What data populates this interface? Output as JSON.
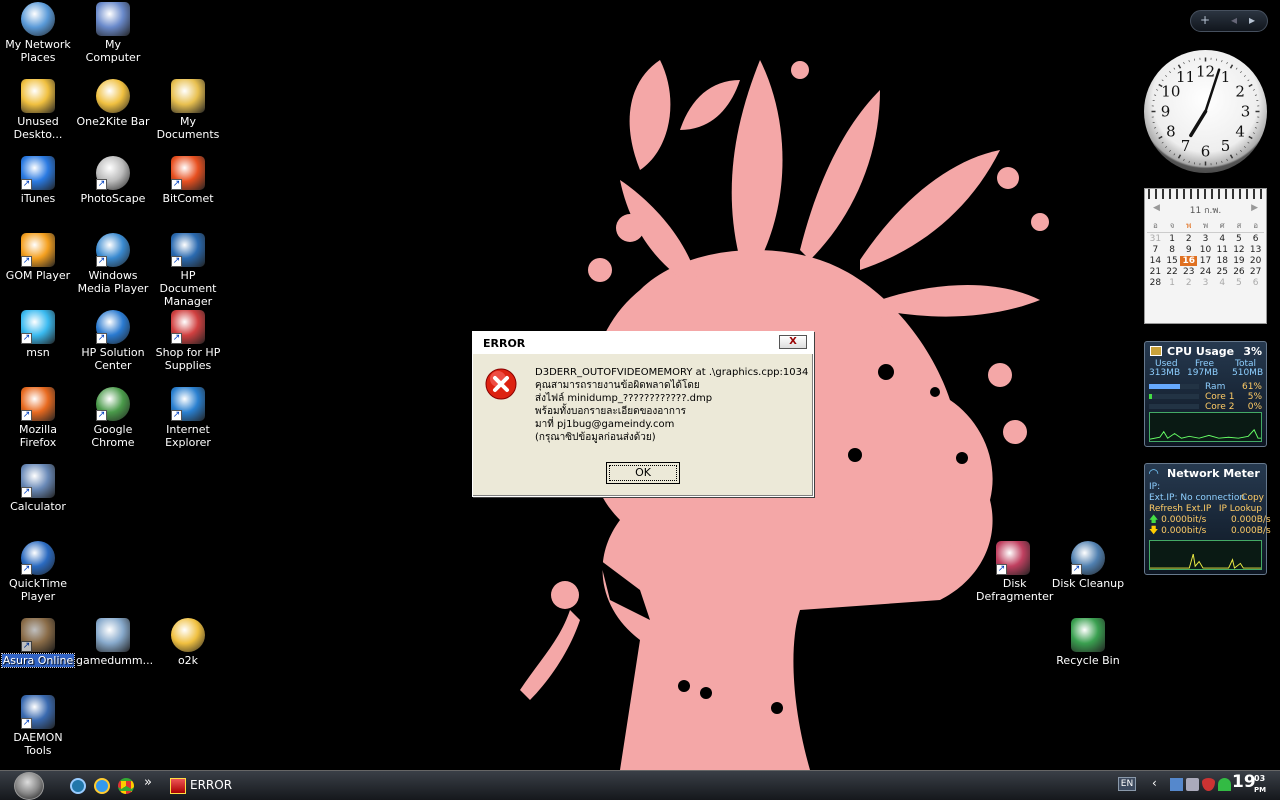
{
  "desktop": {
    "icons": [
      {
        "label": "My Network Places",
        "name": "my-network-places-icon",
        "sel": false
      },
      {
        "label": "My Computer",
        "name": "my-computer-icon",
        "sel": false
      },
      {
        "label": "Unused Deskto...",
        "name": "unused-desktop-folder-icon",
        "sel": false
      },
      {
        "label": "One2Kite Bar",
        "name": "one2kite-bar-folder-icon",
        "sel": false
      },
      {
        "label": "My Documents",
        "name": "my-documents-icon",
        "sel": false
      },
      {
        "label": "iTunes",
        "name": "itunes-icon",
        "sel": false
      },
      {
        "label": "PhotoScape",
        "name": "photoscape-icon",
        "sel": false
      },
      {
        "label": "BitComet",
        "name": "bitcomet-icon",
        "sel": false
      },
      {
        "label": "GOM Player",
        "name": "gom-player-icon",
        "sel": false
      },
      {
        "label": "Windows Media Player",
        "name": "windows-media-player-icon",
        "sel": false
      },
      {
        "label": "HP Document Manager",
        "name": "hp-document-manager-icon",
        "sel": false
      },
      {
        "label": "msn",
        "name": "msn-icon",
        "sel": false
      },
      {
        "label": "HP Solution Center",
        "name": "hp-solution-center-icon",
        "sel": false
      },
      {
        "label": "Shop for HP Supplies",
        "name": "shop-hp-supplies-icon",
        "sel": false
      },
      {
        "label": "Mozilla Firefox",
        "name": "mozilla-firefox-icon",
        "sel": false
      },
      {
        "label": "Google Chrome",
        "name": "google-chrome-icon",
        "sel": false
      },
      {
        "label": "Internet Explorer",
        "name": "internet-explorer-icon",
        "sel": false
      },
      {
        "label": "Calculator",
        "name": "calculator-icon",
        "sel": false
      },
      {
        "label": "QuickTime Player",
        "name": "quicktime-player-icon",
        "sel": false
      },
      {
        "label": "Asura Online",
        "name": "asura-online-icon",
        "sel": true
      },
      {
        "label": "gamedumm...",
        "name": "gamedummy-icon",
        "sel": false
      },
      {
        "label": "o2k",
        "name": "o2k-folder-icon",
        "sel": false
      },
      {
        "label": "DAEMON Tools",
        "name": "daemon-tools-icon",
        "sel": false
      },
      {
        "label": "Disk Defragmenter",
        "name": "disk-defragmenter-icon",
        "sel": false
      },
      {
        "label": "Disk Cleanup",
        "name": "disk-cleanup-icon",
        "sel": false
      },
      {
        "label": "Recycle Bin",
        "name": "recycle-bin-icon",
        "sel": false
      }
    ]
  },
  "gadgets": {
    "bar": {
      "add": "+",
      "prev": "◂",
      "next": "▸"
    },
    "clock": {
      "hour": 7,
      "minute": 3,
      "numerals": [
        "12",
        "1",
        "2",
        "3",
        "4",
        "5",
        "6",
        "7",
        "8",
        "9",
        "10",
        "11"
      ]
    },
    "calendar": {
      "month_label": "11 ก.พ.",
      "weekday_headers": [
        "อ",
        "จ",
        "พ",
        "พ",
        "ศ",
        "ส",
        "อ"
      ],
      "days": [
        [
          "31",
          "1",
          "2",
          "3",
          "4",
          "5",
          "6"
        ],
        [
          "7",
          "8",
          "9",
          "10",
          "11",
          "12",
          "13"
        ],
        [
          "14",
          "15",
          "16",
          "17",
          "18",
          "19",
          "20"
        ],
        [
          "21",
          "22",
          "23",
          "24",
          "25",
          "26",
          "27"
        ],
        [
          "28",
          "1",
          "2",
          "3",
          "4",
          "5",
          "6"
        ]
      ],
      "today": "16"
    },
    "cpu": {
      "title": "CPU Usage",
      "percent": "3%",
      "used_label": "Used",
      "free_label": "Free",
      "total_label": "Total",
      "used": "313MB",
      "free": "197MB",
      "total": "510MB",
      "ram_label": "Ram",
      "ram": "61%",
      "core1_label": "Core 1",
      "core1": "5%",
      "core2_label": "Core 2",
      "core2": "0%"
    },
    "network": {
      "title": "Network Meter",
      "ip_label": "IP:",
      "ext_ip": "Ext.IP: No connection",
      "copy": "Copy",
      "refresh": "Refresh Ext.IP",
      "lookup": "IP Lookup",
      "up_bits": "0.000bit/s",
      "up_bytes": "0.000B/s",
      "down_bits": "0.000bit/s",
      "down_bytes": "0.000B/s"
    }
  },
  "dialog": {
    "title": "ERROR",
    "close": "X",
    "lines": [
      "D3DERR_OUTOFVIDEOMEMORY at .\\graphics.cpp:1034",
      "คุณสามารถรายงานข้อผิดพลาดได้โดย",
      "ส่งไฟล์ minidump_????????????.dmp",
      "พร้อมทั้งบอกรายละเอียดของอาการ",
      "มาที่ pj1bug@gameindy.com",
      "(กรุณาซิปข้อมูลก่อนส่งด้วย)"
    ],
    "ok": "OK"
  },
  "taskbar": {
    "chevron": "»",
    "task_label": "ERROR",
    "lang": "EN",
    "time_hour": "19",
    "time_min": "03",
    "ampm": "PM"
  },
  "colors": {
    "wallpaper": "#f4a7a7",
    "dialog_bg": "#ece9d8"
  }
}
